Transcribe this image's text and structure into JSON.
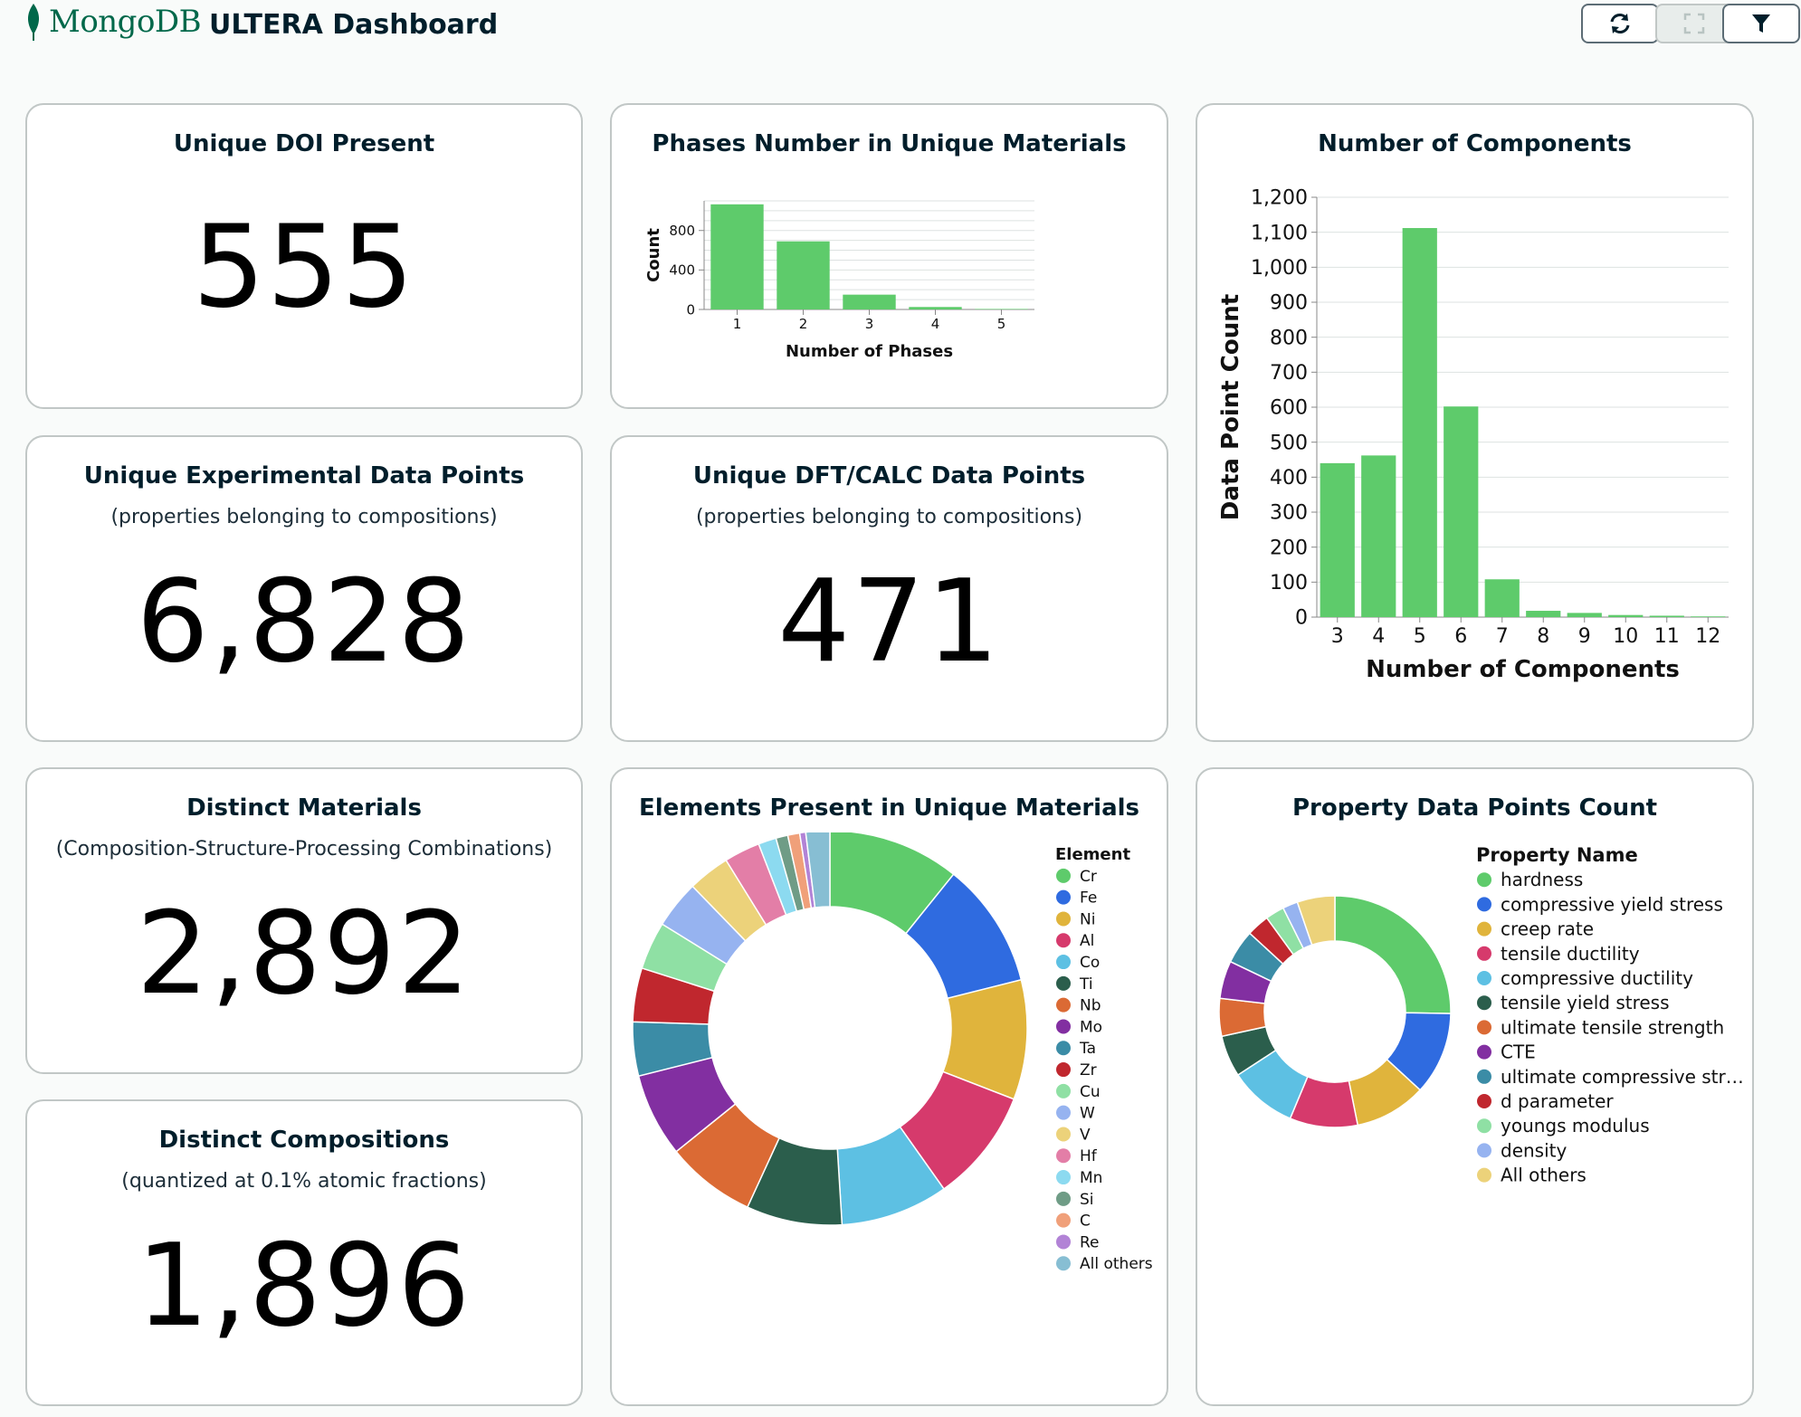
{
  "header": {
    "logo_text": "MongoDB",
    "title": "ULTERA Dashboard",
    "buttons": [
      {
        "icon": "refresh-icon"
      },
      {
        "icon": "fullscreen-icon"
      },
      {
        "icon": "filter-icon"
      }
    ]
  },
  "colors": {
    "accent_green": "#5ecb6b",
    "brand_green": "#00684a"
  },
  "cards": {
    "doi": {
      "title": "Unique DOI Present",
      "value": "555"
    },
    "experimental": {
      "title": "Unique Experimental Data Points",
      "subtitle": "(properties belonging to compositions)",
      "value": "6,828"
    },
    "dft": {
      "title": "Unique DFT/CALC Data Points",
      "subtitle": "(properties belonging to compositions)",
      "value": "471"
    },
    "materials": {
      "title": "Distinct Materials",
      "subtitle": "(Composition-Structure-Processing Combinations)",
      "value": "2,892"
    },
    "compositions": {
      "title": "Distinct Compositions",
      "subtitle": "(quantized at 0.1% atomic fractions)",
      "value": "1,896"
    },
    "phases": {
      "title": "Phases Number in Unique Materials"
    },
    "components": {
      "title": "Number of Components"
    },
    "elements": {
      "title": "Elements Present in Unique Materials"
    },
    "properties": {
      "title": "Property Data Points Count"
    }
  },
  "chart_data": [
    {
      "type": "bar",
      "title": "Phases Number in Unique Materials",
      "xlabel": "Number of Phases",
      "ylabel": "Count",
      "categories": [
        "1",
        "2",
        "3",
        "4",
        "5"
      ],
      "values": [
        1065,
        690,
        150,
        25,
        5
      ],
      "ylim": [
        0,
        1100
      ],
      "yticks": [
        "0",
        "400",
        "800"
      ],
      "grid": true
    },
    {
      "type": "bar",
      "title": "Number of Components",
      "xlabel": "Number of Components",
      "ylabel": "Data Point Count",
      "categories": [
        "3",
        "4",
        "5",
        "6",
        "7",
        "8",
        "9",
        "10",
        "11",
        "12"
      ],
      "values": [
        440,
        462,
        1112,
        602,
        108,
        18,
        12,
        6,
        4,
        2
      ],
      "ylim": [
        0,
        1200
      ],
      "yticks": [
        "0",
        "100",
        "200",
        "300",
        "400",
        "500",
        "600",
        "700",
        "800",
        "900",
        "1,000",
        "1,100",
        "1,200"
      ],
      "grid": true
    },
    {
      "type": "pie",
      "title": "Elements Present in Unique Materials",
      "legend_title": "Element",
      "legend_position": "right",
      "slices": [
        {
          "label": "Cr",
          "value": 11.0,
          "color": "#5ecb6b"
        },
        {
          "label": "Fe",
          "value": 10.5,
          "color": "#2f6be0"
        },
        {
          "label": "Ni",
          "value": 10.0,
          "color": "#e0b43c"
        },
        {
          "label": "Al",
          "value": 9.5,
          "color": "#d63a6c"
        },
        {
          "label": "Co",
          "value": 9.0,
          "color": "#5dc0e3"
        },
        {
          "label": "Ti",
          "value": 8.0,
          "color": "#2b5e4c"
        },
        {
          "label": "Nb",
          "value": 7.5,
          "color": "#db6a34"
        },
        {
          "label": "Mo",
          "value": 7.0,
          "color": "#822fa1"
        },
        {
          "label": "Ta",
          "value": 4.5,
          "color": "#3b8ca6"
        },
        {
          "label": "Zr",
          "value": 4.5,
          "color": "#c0272e"
        },
        {
          "label": "Cu",
          "value": 4.0,
          "color": "#8fe0a4"
        },
        {
          "label": "W",
          "value": 4.0,
          "color": "#96b3f0"
        },
        {
          "label": "V",
          "value": 3.5,
          "color": "#ecd27a"
        },
        {
          "label": "Hf",
          "value": 3.0,
          "color": "#e37ea7"
        },
        {
          "label": "Mn",
          "value": 1.5,
          "color": "#8cdaf0"
        },
        {
          "label": "Si",
          "value": 1.0,
          "color": "#6f9c86"
        },
        {
          "label": "C",
          "value": 1.0,
          "color": "#f0a07a"
        },
        {
          "label": "Re",
          "value": 0.5,
          "color": "#b283d6"
        },
        {
          "label": "All others",
          "value": 2.0,
          "color": "#87bed3"
        }
      ]
    },
    {
      "type": "pie",
      "title": "Property Data Points Count",
      "legend_title": "Property Name",
      "legend_position": "right",
      "slices": [
        {
          "label": "hardness",
          "value": 24.0,
          "color": "#5ecb6b"
        },
        {
          "label": "compressive yield stress",
          "value": 11.0,
          "color": "#2f6be0"
        },
        {
          "label": "creep rate",
          "value": 9.5,
          "color": "#e0b43c"
        },
        {
          "label": "tensile ductility",
          "value": 9.0,
          "color": "#d63a6c"
        },
        {
          "label": "compressive ductility",
          "value": 9.0,
          "color": "#5dc0e3"
        },
        {
          "label": "tensile yield stress",
          "value": 5.5,
          "color": "#2b5e4c"
        },
        {
          "label": "ultimate tensile strength",
          "value": 5.0,
          "color": "#db6a34"
        },
        {
          "label": "CTE",
          "value": 5.0,
          "color": "#822fa1"
        },
        {
          "label": "ultimate compressive str…",
          "value": 4.5,
          "color": "#3b8ca6"
        },
        {
          "label": "d parameter",
          "value": 3.0,
          "color": "#c0272e"
        },
        {
          "label": "youngs modulus",
          "value": 2.5,
          "color": "#8fe0a4"
        },
        {
          "label": "density",
          "value": 2.0,
          "color": "#96b3f0"
        },
        {
          "label": "All others",
          "value": 5.0,
          "color": "#ecd27a"
        }
      ]
    }
  ]
}
